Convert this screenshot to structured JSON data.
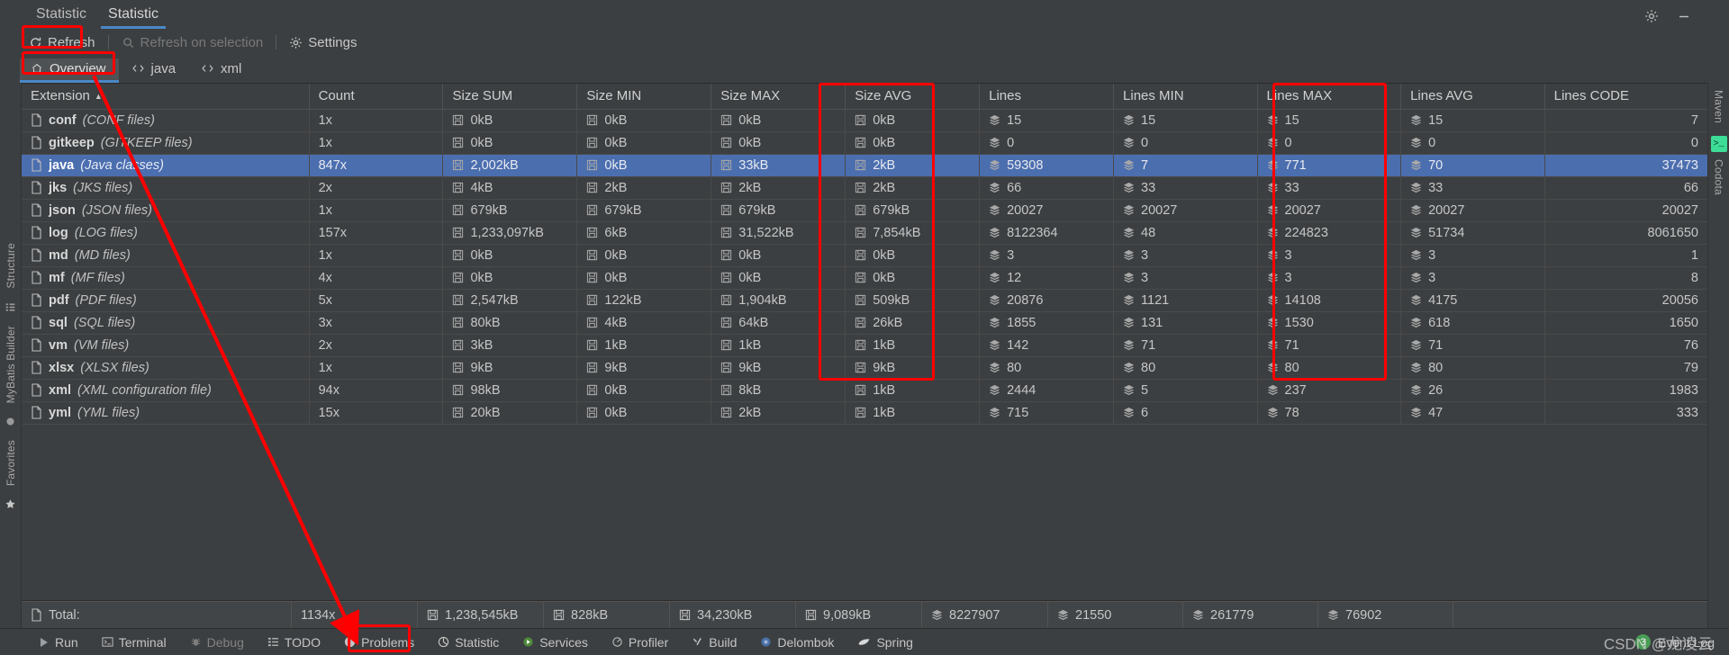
{
  "window": {
    "tabs": [
      {
        "label": "Statistic",
        "active": false
      },
      {
        "label": "Statistic",
        "active": true
      }
    ],
    "settings_icon": "gear-icon",
    "minimize_icon": "minimize-icon"
  },
  "toolbar": {
    "refresh_label": "Refresh",
    "refresh_icon": "refresh-icon",
    "refresh_on_selection_label": "Refresh on selection",
    "refresh_on_selection_icon": "search-icon",
    "settings_label": "Settings",
    "settings_icon": "gear-icon"
  },
  "view_tabs": [
    {
      "label": "Overview",
      "icon": "home-icon",
      "active": true
    },
    {
      "label": "java",
      "icon": "code-brackets-icon",
      "active": false
    },
    {
      "label": "xml",
      "icon": "code-brackets-icon",
      "active": false
    }
  ],
  "left_rail": {
    "items": [
      "Structure",
      "MyBatis Builder",
      "Favorites"
    ]
  },
  "right_rail": {
    "items": [
      "Maven",
      "Codota"
    ]
  },
  "table": {
    "columns": [
      {
        "key": "extension",
        "label": "Extension",
        "sorted": true,
        "sort_dir": "asc",
        "align": "left"
      },
      {
        "key": "count",
        "label": "Count",
        "align": "left"
      },
      {
        "key": "size_sum",
        "label": "Size SUM",
        "align": "left"
      },
      {
        "key": "size_min",
        "label": "Size MIN",
        "align": "left"
      },
      {
        "key": "size_max",
        "label": "Size MAX",
        "align": "left"
      },
      {
        "key": "size_avg",
        "label": "Size AVG",
        "align": "left"
      },
      {
        "key": "lines",
        "label": "Lines",
        "align": "left"
      },
      {
        "key": "lines_min",
        "label": "Lines MIN",
        "align": "left"
      },
      {
        "key": "lines_max",
        "label": "Lines MAX",
        "align": "left"
      },
      {
        "key": "lines_avg",
        "label": "Lines AVG",
        "align": "left"
      },
      {
        "key": "lines_code",
        "label": "Lines CODE",
        "align": "right"
      }
    ],
    "rows": [
      {
        "ext": "conf",
        "desc": "(CONF files)",
        "count": "1x",
        "size_sum": "0kB",
        "size_min": "0kB",
        "size_max": "0kB",
        "size_avg": "0kB",
        "lines": "15",
        "lines_min": "15",
        "lines_max": "15",
        "lines_avg": "15",
        "lines_code": "7",
        "selected": false
      },
      {
        "ext": "gitkeep",
        "desc": "(GITKEEP files)",
        "count": "1x",
        "size_sum": "0kB",
        "size_min": "0kB",
        "size_max": "0kB",
        "size_avg": "0kB",
        "lines": "0",
        "lines_min": "0",
        "lines_max": "0",
        "lines_avg": "0",
        "lines_code": "0",
        "selected": false
      },
      {
        "ext": "java",
        "desc": "(Java classes)",
        "count": "847x",
        "size_sum": "2,002kB",
        "size_min": "0kB",
        "size_max": "33kB",
        "size_avg": "2kB",
        "lines": "59308",
        "lines_min": "7",
        "lines_max": "771",
        "lines_avg": "70",
        "lines_code": "37473",
        "selected": true
      },
      {
        "ext": "jks",
        "desc": "(JKS files)",
        "count": "2x",
        "size_sum": "4kB",
        "size_min": "2kB",
        "size_max": "2kB",
        "size_avg": "2kB",
        "lines": "66",
        "lines_min": "33",
        "lines_max": "33",
        "lines_avg": "33",
        "lines_code": "66",
        "selected": false
      },
      {
        "ext": "json",
        "desc": "(JSON files)",
        "count": "1x",
        "size_sum": "679kB",
        "size_min": "679kB",
        "size_max": "679kB",
        "size_avg": "679kB",
        "lines": "20027",
        "lines_min": "20027",
        "lines_max": "20027",
        "lines_avg": "20027",
        "lines_code": "20027",
        "selected": false
      },
      {
        "ext": "log",
        "desc": "(LOG files)",
        "count": "157x",
        "size_sum": "1,233,097kB",
        "size_min": "6kB",
        "size_max": "31,522kB",
        "size_avg": "7,854kB",
        "lines": "8122364",
        "lines_min": "48",
        "lines_max": "224823",
        "lines_avg": "51734",
        "lines_code": "8061650",
        "selected": false
      },
      {
        "ext": "md",
        "desc": "(MD files)",
        "count": "1x",
        "size_sum": "0kB",
        "size_min": "0kB",
        "size_max": "0kB",
        "size_avg": "0kB",
        "lines": "3",
        "lines_min": "3",
        "lines_max": "3",
        "lines_avg": "3",
        "lines_code": "1",
        "selected": false
      },
      {
        "ext": "mf",
        "desc": "(MF files)",
        "count": "4x",
        "size_sum": "0kB",
        "size_min": "0kB",
        "size_max": "0kB",
        "size_avg": "0kB",
        "lines": "12",
        "lines_min": "3",
        "lines_max": "3",
        "lines_avg": "3",
        "lines_code": "8",
        "selected": false
      },
      {
        "ext": "pdf",
        "desc": "(PDF files)",
        "count": "5x",
        "size_sum": "2,547kB",
        "size_min": "122kB",
        "size_max": "1,904kB",
        "size_avg": "509kB",
        "lines": "20876",
        "lines_min": "1121",
        "lines_max": "14108",
        "lines_avg": "4175",
        "lines_code": "20056",
        "selected": false
      },
      {
        "ext": "sql",
        "desc": "(SQL files)",
        "count": "3x",
        "size_sum": "80kB",
        "size_min": "4kB",
        "size_max": "64kB",
        "size_avg": "26kB",
        "lines": "1855",
        "lines_min": "131",
        "lines_max": "1530",
        "lines_avg": "618",
        "lines_code": "1650",
        "selected": false
      },
      {
        "ext": "vm",
        "desc": "(VM files)",
        "count": "2x",
        "size_sum": "3kB",
        "size_min": "1kB",
        "size_max": "1kB",
        "size_avg": "1kB",
        "lines": "142",
        "lines_min": "71",
        "lines_max": "71",
        "lines_avg": "71",
        "lines_code": "76",
        "selected": false
      },
      {
        "ext": "xlsx",
        "desc": "(XLSX files)",
        "count": "1x",
        "size_sum": "9kB",
        "size_min": "9kB",
        "size_max": "9kB",
        "size_avg": "9kB",
        "lines": "80",
        "lines_min": "80",
        "lines_max": "80",
        "lines_avg": "80",
        "lines_code": "79",
        "selected": false
      },
      {
        "ext": "xml",
        "desc": "(XML configuration file)",
        "count": "94x",
        "size_sum": "98kB",
        "size_min": "0kB",
        "size_max": "8kB",
        "size_avg": "1kB",
        "lines": "2444",
        "lines_min": "5",
        "lines_max": "237",
        "lines_avg": "26",
        "lines_code": "1983",
        "selected": false
      },
      {
        "ext": "yml",
        "desc": "(YML files)",
        "count": "15x",
        "size_sum": "20kB",
        "size_min": "0kB",
        "size_max": "2kB",
        "size_avg": "1kB",
        "lines": "715",
        "lines_min": "6",
        "lines_max": "78",
        "lines_avg": "47",
        "lines_code": "333",
        "selected": false
      }
    ],
    "total": {
      "label": "Total:",
      "count": "1134x",
      "size_sum": "1,238,545kB",
      "size_min": "828kB",
      "size_max": "34,230kB",
      "size_avg": "9,089kB",
      "lines": "8227907",
      "lines_min": "21550",
      "lines_max": "261779",
      "lines_avg": "76902"
    }
  },
  "statusbar": {
    "items": [
      {
        "label": "Run",
        "icon": "play-icon",
        "dim": false,
        "active": false
      },
      {
        "label": "Terminal",
        "icon": "terminal-icon",
        "dim": false,
        "active": false
      },
      {
        "label": "Debug",
        "icon": "bug-icon",
        "dim": true,
        "active": false
      },
      {
        "label": "TODO",
        "icon": "list-icon",
        "dim": false,
        "active": false
      },
      {
        "label": "Problems",
        "icon": "warning-icon",
        "dim": false,
        "active": false
      },
      {
        "label": "Statistic",
        "icon": "pie-chart-icon",
        "dim": false,
        "active": true
      },
      {
        "label": "Services",
        "icon": "services-icon",
        "dim": false,
        "active": false
      },
      {
        "label": "Profiler",
        "icon": "profiler-icon",
        "dim": false,
        "active": false
      },
      {
        "label": "Build",
        "icon": "hammer-icon",
        "dim": false,
        "active": false
      },
      {
        "label": "Delombok",
        "icon": "lombok-icon",
        "dim": false,
        "active": false
      },
      {
        "label": "Spring",
        "icon": "leaf-icon",
        "dim": false,
        "active": false
      }
    ],
    "event_log_label": "Event Log",
    "event_log_count": "3",
    "watermark": "CSDN @龙凌云"
  },
  "annotations": {
    "color": "#ff0000",
    "boxes": [
      "refresh-button",
      "overview-tab",
      "lines-column",
      "lines-code-column",
      "statistic-status-tab"
    ],
    "arrow": "points from Overview tab down to Statistic status tab"
  }
}
